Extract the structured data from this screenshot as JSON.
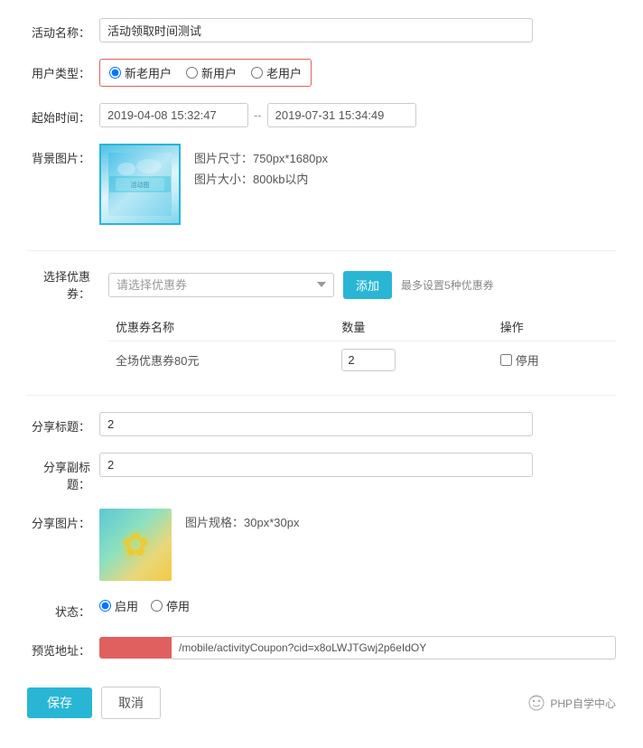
{
  "form": {
    "activity_name_label": "活动名称：",
    "activity_name_value": "活动领取时间测试",
    "user_type_label": "用户类型：",
    "user_types": [
      {
        "id": "all",
        "label": "新老用户",
        "checked": true
      },
      {
        "id": "new",
        "label": "新用户",
        "checked": false
      },
      {
        "id": "old",
        "label": "老用户",
        "checked": false
      }
    ],
    "start_time_label": "起始时间：",
    "start_time": "2019-04-08 15:32:47",
    "end_time": "2019-07-31 15:34:49",
    "bg_image_label": "背景图片：",
    "bg_image_size": "图片尺寸：750px*1680px",
    "bg_image_maxsize": "图片大小：800kb以内",
    "coupon_select_label": "选择优惠券：",
    "coupon_placeholder": "请选择优惠券",
    "add_button_label": "添加",
    "add_tip": "最多设置5种优惠券",
    "coupon_table_headers": [
      "优惠券名称",
      "数量",
      "操作"
    ],
    "coupon_rows": [
      {
        "name": "全场优惠券80元",
        "quantity": "2",
        "disabled": false
      }
    ],
    "disable_label": "停用",
    "share_title_label": "分享标题：",
    "share_title_value": "2",
    "share_subtitle_label": "分享副标题：",
    "share_subtitle_value": "2",
    "share_image_label": "分享图片：",
    "share_image_spec": "图片规格：30px*30px",
    "status_label": "状态：",
    "status_options": [
      {
        "id": "enable",
        "label": "启用",
        "checked": true
      },
      {
        "id": "disable",
        "label": "停用",
        "checked": false
      }
    ],
    "preview_url_label": "预览地址：",
    "preview_url_red": "",
    "preview_url_path": "/mobile/activityCoupon?cid=x8oLWJTGwj2p6eIdOY",
    "save_button": "保存",
    "cancel_button": "取消",
    "footer_brand": "PHP自学中心"
  }
}
